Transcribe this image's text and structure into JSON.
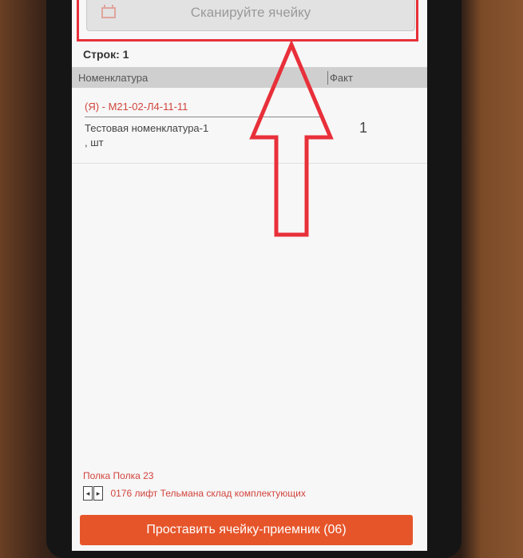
{
  "scan": {
    "placeholder_text": "Сканируйте ячейку",
    "icon": "scan-cell-icon"
  },
  "rows_count": "Строк: 1",
  "table": {
    "headers": {
      "nomenclature": "Номенклатура",
      "fact": "Факт"
    },
    "rows": [
      {
        "code": "(Я) - М21-02-Л4-11-11",
        "name": "Тестовая номенклатура-1",
        "unit": ", шт",
        "fact": "1"
      }
    ]
  },
  "footer": {
    "shelf": "Полка Полка 23",
    "nav_prev": "◂",
    "nav_next": "▸",
    "cell": "0176 лифт Тельмана склад комплектующих",
    "action_button": "Проставить ячейку-приемник (06)"
  },
  "colors": {
    "accent": "#e6552a",
    "annotation_red": "#e8303a",
    "link_red": "#d2443d"
  }
}
